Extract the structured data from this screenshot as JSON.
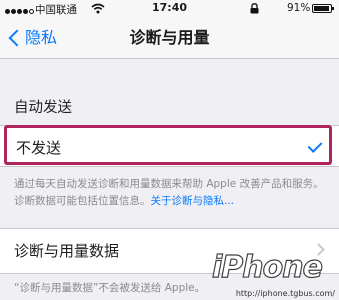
{
  "status_bar": {
    "signal_bars": 5,
    "carrier": "中国联通",
    "time": "17:40",
    "battery_percent": "91%",
    "icons": [
      "signal-icon",
      "wifi-icon",
      "lock-icon",
      "battery-icon"
    ]
  },
  "nav": {
    "back_label": "隐私",
    "title": "诊断与用量"
  },
  "auto_send": {
    "header": "自动发送",
    "options": [
      {
        "label": "不发送",
        "selected": true
      }
    ]
  },
  "footer": {
    "text": "通过每天自动发送诊断和用量数据来帮助 Apple 改善产品和服务。诊断数据可能包括位置信息。",
    "link": "关于诊断与隐私..."
  },
  "data_row": {
    "label": "诊断与用量数据"
  },
  "bottom_note": "“诊断与用量数据”不会被发送给 Apple。",
  "watermark": {
    "logo": "iPhone",
    "url": "http://iphone.tgbus.com/"
  },
  "colors": {
    "accent": "#0a7aff",
    "highlight_border": "#b0245e",
    "background": "#efeff4"
  }
}
